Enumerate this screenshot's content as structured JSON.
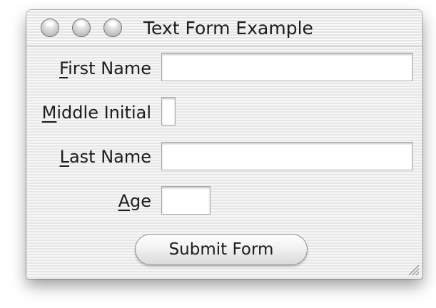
{
  "window": {
    "title": "Text Form Example"
  },
  "form": {
    "first_name": {
      "mnemonic": "F",
      "label_rest": "irst Name",
      "value": ""
    },
    "middle_initial": {
      "mnemonic": "M",
      "label_rest": "iddle Initial",
      "value": ""
    },
    "last_name": {
      "mnemonic": "L",
      "label_rest": "ast Name",
      "value": ""
    },
    "age": {
      "mnemonic": "A",
      "label_rest": "ge",
      "value": ""
    }
  },
  "submit": {
    "label": "Submit Form"
  },
  "icons": {
    "close": "close-button-icon",
    "minimize": "minimize-button-icon",
    "zoom": "zoom-button-icon",
    "resize": "resize-grip-icon"
  }
}
